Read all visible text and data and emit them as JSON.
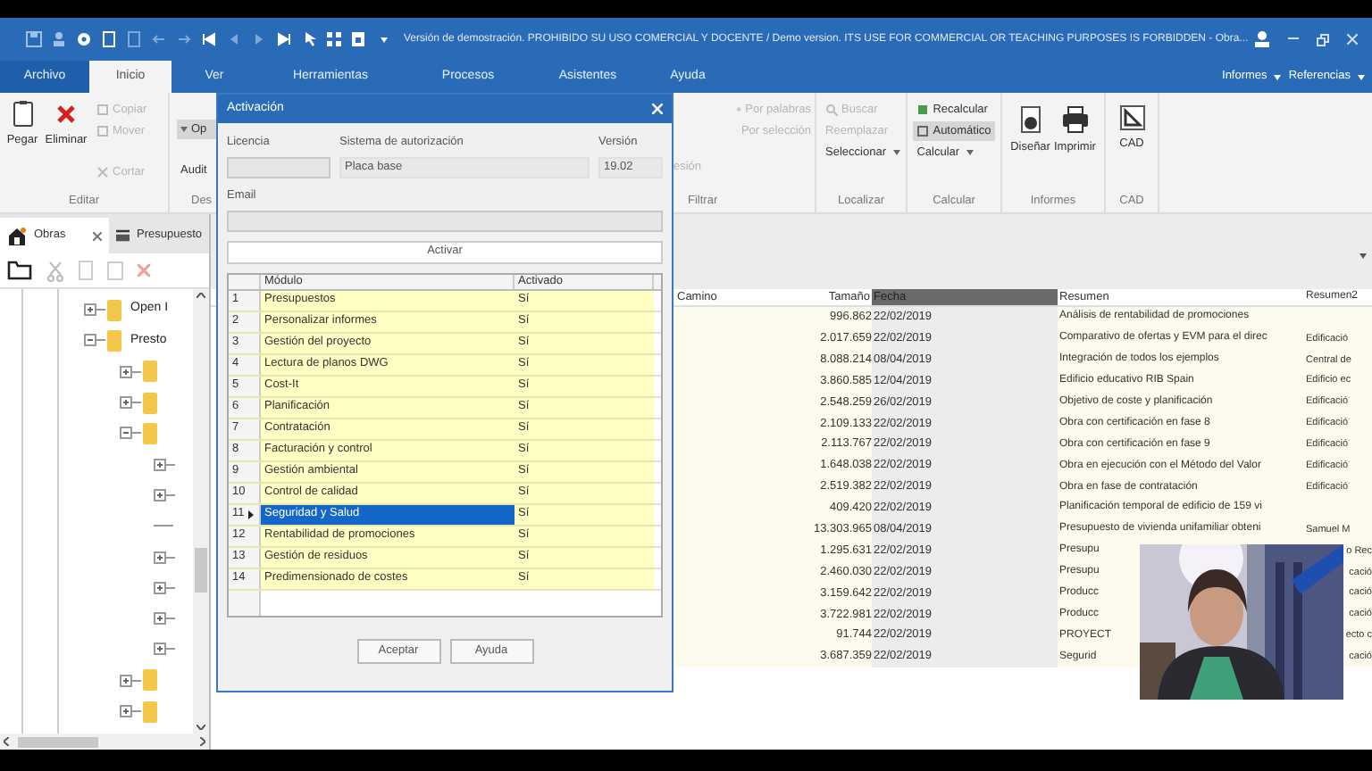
{
  "window": {
    "title": "Versión de demostración. PROHIBIDO SU USO COMERCIAL Y DOCENTE / Demo version. ITS USE FOR COMMERCIAL OR TEACHING PURPOSES IS FORBIDDEN - Obra..."
  },
  "ribbon_tabs": [
    {
      "label": "Archivo",
      "selected": false,
      "kind": "file"
    },
    {
      "label": "Inicio",
      "selected": true
    },
    {
      "label": "Ver",
      "selected": false
    },
    {
      "label": "Herramientas",
      "selected": false
    },
    {
      "label": "Procesos",
      "selected": false
    },
    {
      "label": "Asistentes",
      "selected": false
    },
    {
      "label": "Ayuda",
      "selected": false
    }
  ],
  "ribbon_links": [
    "Informes",
    "Referencias"
  ],
  "ribbon_groups": [
    {
      "label": "Editar",
      "buttons": [
        {
          "label": "Pegar",
          "disabled": false
        },
        {
          "label": "Eliminar",
          "disabled": false
        },
        {
          "label": "Copiar",
          "disabled": true
        },
        {
          "label": "Mover",
          "disabled": true
        },
        {
          "label": "Cortar",
          "disabled": true
        }
      ]
    },
    {
      "label": "Des",
      "buttons": [
        {
          "label": "Op",
          "selected": true
        },
        {
          "label": "Audit",
          "selected": false
        }
      ]
    },
    {
      "label": "Filtrar",
      "buttons": [
        {
          "label": "Por palabras",
          "disabled": true
        },
        {
          "label": "Por selección",
          "disabled": true
        },
        {
          "label": "esión",
          "disabled": true
        }
      ]
    },
    {
      "label": "Localizar",
      "buttons": [
        {
          "label": "Buscar",
          "disabled": true
        },
        {
          "label": "Reemplazar",
          "disabled": true
        },
        {
          "label": "Seleccionar",
          "disabled": false
        }
      ]
    },
    {
      "label": "Calcular",
      "buttons": [
        {
          "label": "Recalcular",
          "selected": false
        },
        {
          "label": "Automático",
          "selected": true
        },
        {
          "label": "Calcular",
          "selected": false
        }
      ]
    },
    {
      "label": "Informes",
      "buttons": [
        {
          "label": "Diseñar"
        },
        {
          "label": "Imprimir"
        }
      ]
    },
    {
      "label": "CAD",
      "buttons": [
        {
          "label": "CAD"
        }
      ]
    }
  ],
  "doc_tabs": [
    {
      "label": "Obras",
      "selected": true
    },
    {
      "label": "Presupuesto",
      "selected": false
    }
  ],
  "tree": [
    {
      "label": "Open I",
      "expanded": false
    },
    {
      "label": "Presto",
      "expanded": true,
      "children": [
        {
          "expanded": false
        },
        {
          "expanded": false
        },
        {
          "expanded": true,
          "children": [
            {
              "expanded": false
            },
            {
              "expanded": false
            },
            {
              "kind": "leaf"
            },
            {
              "expanded": false
            },
            {
              "expanded": false
            },
            {
              "expanded": false
            },
            {
              "expanded": false
            }
          ]
        },
        {
          "expanded": false
        },
        {
          "expanded": false
        }
      ]
    }
  ],
  "table": {
    "columns": [
      {
        "label": "Camino",
        "selected": false
      },
      {
        "label": "Tamaño",
        "selected": false
      },
      {
        "label": "Fecha",
        "selected": true
      },
      {
        "label": "Resumen",
        "selected": false
      },
      {
        "label": "Resumen2",
        "selected": false
      }
    ],
    "rows": [
      {
        "size": "996.862",
        "date": "22/02/2019",
        "summary": "Análisis de rentabilidad de promociones"
      },
      {
        "size": "2.017.659",
        "date": "22/02/2019",
        "summary": "Comparativo de ofertas y EVM para el direc",
        "summary2": "Edificació"
      },
      {
        "size": "8.088.214",
        "date": "08/04/2019",
        "summary": "Integración de todos los ejemplos",
        "summary2": "Central de"
      },
      {
        "size": "3.860.585",
        "date": "12/04/2019",
        "summary": "Edificio educativo RIB Spain",
        "summary2": "Edificio ec"
      },
      {
        "size": "2.548.259",
        "date": "26/02/2019",
        "summary": "Objetivo de coste y planificación",
        "summary2": "Edificació"
      },
      {
        "size": "2.109.133",
        "date": "22/02/2019",
        "summary": "Obra con certificación en fase 8",
        "summary2": "Edificació"
      },
      {
        "size": "2.113.767",
        "date": "22/02/2019",
        "summary": "Obra con certificación en fase 9",
        "summary2": "Edificació"
      },
      {
        "size": "1.648.038",
        "date": "22/02/2019",
        "summary": "Obra en ejecución con el Método del Valor",
        "summary2": "Edificació"
      },
      {
        "size": "2.519.382",
        "date": "22/02/2019",
        "summary": "Obra en fase de contratación",
        "summary2": "Edificació"
      },
      {
        "size": "409.420",
        "date": "22/02/2019",
        "summary": "Planificación temporal de edificio de 159 vi"
      },
      {
        "size": "13.303.965",
        "date": "08/04/2019",
        "summary": "Presupuesto de vivienda unifamiliar obteni",
        "summary2": "Samuel M"
      },
      {
        "size": "1.295.631",
        "date": "22/02/2019",
        "summary": "Presupu",
        "summary2": "o Rec",
        "summary2_cut": true
      },
      {
        "size": "2.460.030",
        "date": "22/02/2019",
        "summary": "Presupu",
        "summary2": "cació",
        "summary2_cut": true
      },
      {
        "size": "3.159.642",
        "date": "22/02/2019",
        "summary": "Producc",
        "summary2": "cació",
        "summary2_cut": true
      },
      {
        "size": "3.722.981",
        "date": "22/02/2019",
        "summary": "Producc",
        "summary2": "cació",
        "summary2_cut": true
      },
      {
        "size": "91.744",
        "date": "22/02/2019",
        "summary": "PROYECT",
        "summary2": "ecto c",
        "summary2_cut": true
      },
      {
        "size": "3.687.359",
        "date": "22/02/2019",
        "summary": "Segurid",
        "summary2": "cació",
        "summary2_cut": true
      }
    ]
  },
  "dialog": {
    "title": "Activación",
    "license_label": "Licencia",
    "system_label": "Sistema de autorización",
    "system": "Placa base",
    "version_label": "Versión",
    "version": "19.02",
    "email_label": "Email",
    "activate": "Activar",
    "columns": [
      "Módulo",
      "Activado"
    ],
    "modules": [
      {
        "number": "1",
        "name": "Presupuestos",
        "active": "Sí",
        "selected": false
      },
      {
        "number": "2",
        "name": "Personalizar informes",
        "active": "Sí",
        "selected": false
      },
      {
        "number": "3",
        "name": "Gestión del proyecto",
        "active": "Sí",
        "selected": false
      },
      {
        "number": "4",
        "name": "Lectura de planos DWG",
        "active": "Sí",
        "selected": false
      },
      {
        "number": "5",
        "name": "Cost-It",
        "active": "Sí",
        "selected": false
      },
      {
        "number": "6",
        "name": "Planificación",
        "active": "Sí",
        "selected": false
      },
      {
        "number": "7",
        "name": "Contratación",
        "active": "Sí",
        "selected": false
      },
      {
        "number": "8",
        "name": "Facturación y control",
        "active": "Sí",
        "selected": false
      },
      {
        "number": "9",
        "name": "Gestión ambiental",
        "active": "Sí",
        "selected": false
      },
      {
        "number": "10",
        "name": "Control de calidad",
        "active": "Sí",
        "selected": false
      },
      {
        "number": "11",
        "name": "Seguridad y Salud",
        "active": "Sí",
        "selected": true
      },
      {
        "number": "12",
        "name": "Rentabilidad de promociones",
        "active": "Sí",
        "selected": false
      },
      {
        "number": "13",
        "name": "Gestión de residuos",
        "active": "Sí",
        "selected": false
      },
      {
        "number": "14",
        "name": "Predimensionado de costes",
        "active": "Sí",
        "selected": false
      }
    ],
    "buttons": [
      "Aceptar",
      "Ayuda"
    ]
  },
  "webcam": {
    "kind": "picture"
  }
}
